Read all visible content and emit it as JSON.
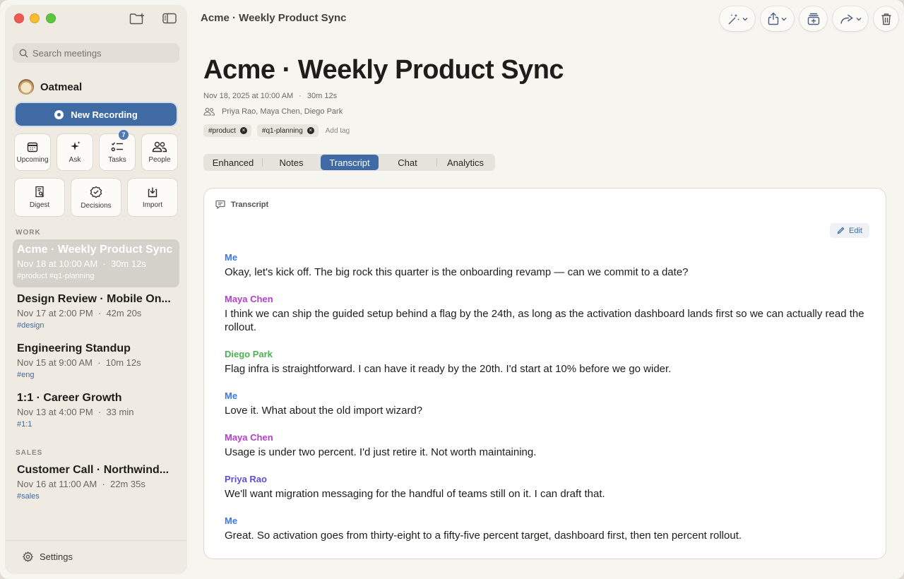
{
  "window": {
    "title": "Acme · Weekly Product Sync"
  },
  "sidebar": {
    "search_placeholder": "Search meetings",
    "brand_name": "Oatmeal",
    "new_recording_label": "New Recording",
    "quick_actions": [
      {
        "label": "Upcoming",
        "icon": "calendar-icon"
      },
      {
        "label": "Ask",
        "icon": "sparkles-icon"
      },
      {
        "label": "Tasks",
        "icon": "checklist-icon",
        "badge": "7"
      },
      {
        "label": "People",
        "icon": "people-icon"
      },
      {
        "label": "Digest",
        "icon": "digest-icon"
      },
      {
        "label": "Decisions",
        "icon": "decision-badge-icon"
      },
      {
        "label": "Import",
        "icon": "import-icon"
      }
    ],
    "sections": [
      {
        "label": "WORK",
        "meetings": [
          {
            "title": "Acme · Weekly Product Sync",
            "meta": "Nov 18 at 10:00 AM  ·  30m 12s",
            "tags": "#product #q1-planning",
            "active": true
          },
          {
            "title": "Design Review · Mobile On...",
            "meta": "Nov 17 at 2:00 PM  ·  42m 20s",
            "tags": "#design"
          },
          {
            "title": "Engineering Standup",
            "meta": "Nov 15 at 9:00 AM  ·  10m 12s",
            "tags": "#eng"
          },
          {
            "title": "1:1 · Career Growth",
            "meta": "Nov 13 at 4:00 PM  ·  33 min",
            "tags": "#1:1"
          }
        ]
      },
      {
        "label": "SALES",
        "meetings": [
          {
            "title": "Customer Call · Northwind...",
            "meta": "Nov 16 at 11:00 AM  ·  22m 35s",
            "tags": "#sales"
          }
        ]
      }
    ],
    "settings_label": "Settings"
  },
  "toolbar": {
    "buttons": [
      "magic-wand-icon",
      "share-icon",
      "add-to-stack-icon",
      "forward-icon",
      "trash-icon"
    ]
  },
  "meeting": {
    "title": "Acme · Weekly Product Sync",
    "date": "Nov 18, 2025 at 10:00 AM",
    "separator": "·",
    "duration": "30m 12s",
    "participants": "Priya Rao, Maya Chen, Diego Park",
    "tags": [
      "#product",
      "#q1-planning"
    ],
    "add_tag_label": "Add tag"
  },
  "tabs": [
    {
      "label": "Enhanced"
    },
    {
      "label": "Notes"
    },
    {
      "label": "Transcript",
      "active": true
    },
    {
      "label": "Chat"
    },
    {
      "label": "Analytics"
    }
  ],
  "transcript": {
    "header": "Transcript",
    "edit_label": "Edit",
    "speaker_colors": {
      "Me": "#3b78e7",
      "Maya Chen": "#b23ec9",
      "Diego Park": "#4bb14f",
      "Priya Rao": "#5b4fd6"
    },
    "utterances": [
      {
        "speaker": "Me",
        "text": "Okay, let's kick off. The big rock this quarter is the onboarding revamp — can we commit to a date?"
      },
      {
        "speaker": "Maya Chen",
        "text": "I think we can ship the guided setup behind a flag by the 24th, as long as the activation dashboard lands first so we can actually read the rollout."
      },
      {
        "speaker": "Diego Park",
        "text": "Flag infra is straightforward. I can have it ready by the 20th. I'd start at 10% before we go wider."
      },
      {
        "speaker": "Me",
        "text": "Love it. What about the old import wizard?"
      },
      {
        "speaker": "Maya Chen",
        "text": "Usage is under two percent. I'd just retire it. Not worth maintaining."
      },
      {
        "speaker": "Priya Rao",
        "text": "We'll want migration messaging for the handful of teams still on it. I can draft that."
      },
      {
        "speaker": "Me",
        "text": "Great. So activation goes from thirty-eight to a fifty-five percent target, dashboard first, then ten percent rollout."
      }
    ]
  }
}
